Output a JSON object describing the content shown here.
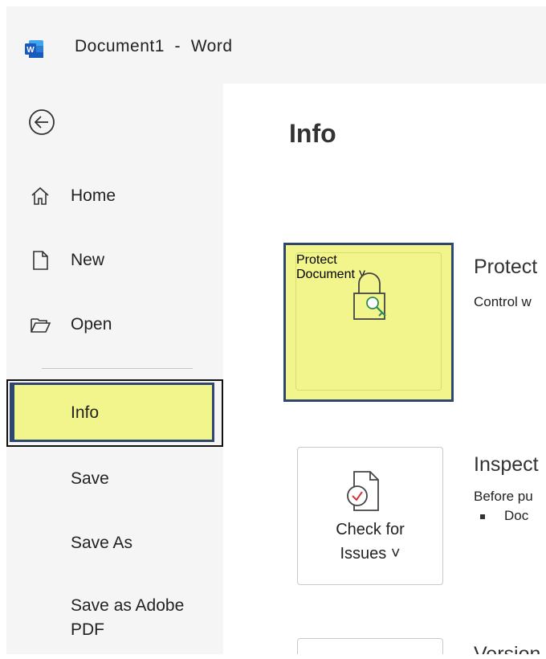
{
  "window": {
    "title": "Document1  -  Word",
    "app_icon_letter": "W"
  },
  "sidebar": {
    "items": [
      {
        "label": "Home",
        "icon": "home-icon"
      },
      {
        "label": "New",
        "icon": "new-document-icon"
      },
      {
        "label": "Open",
        "icon": "folder-open-icon"
      }
    ],
    "info_label": "Info",
    "bottom_items": [
      {
        "label": "Save"
      },
      {
        "label": "Save As"
      },
      {
        "label": "Save as Adobe"
      },
      {
        "label": "PDF"
      }
    ]
  },
  "main": {
    "title": "Info",
    "protect": {
      "tile_line1": "Protect",
      "tile_line2": "Document ˅",
      "heading": "Protect",
      "description": "Control w"
    },
    "inspect": {
      "tile_line1": "Check for",
      "tile_line2": "Issues ˅",
      "heading": "Inspect",
      "description": "Before pu",
      "bullet": "Doc"
    },
    "version": {
      "heading": "Version"
    }
  },
  "colors": {
    "highlight": "#f1f58b",
    "outline": "#2f4770",
    "word_blue": "#185abd"
  }
}
